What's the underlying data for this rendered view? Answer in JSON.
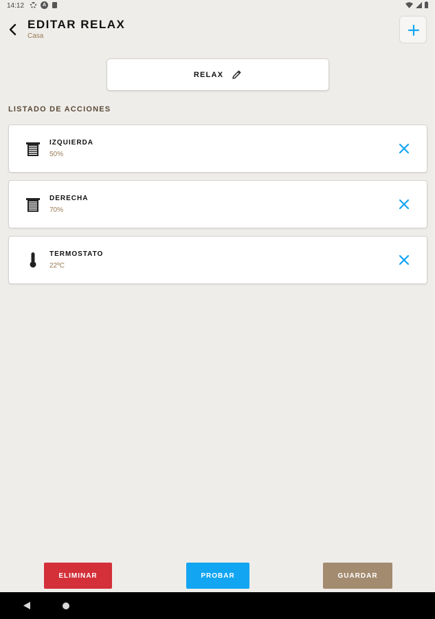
{
  "status_bar": {
    "time": "14:12"
  },
  "header": {
    "title": "EDITAR RELAX",
    "subtitle": "Casa"
  },
  "scene": {
    "name": "RELAX"
  },
  "actions_section": {
    "title": "LISTADO DE ACCIONES",
    "items": [
      {
        "name": "IZQUIERDA",
        "value": "50%",
        "icon": "blind-icon"
      },
      {
        "name": "DERECHA",
        "value": "70%",
        "icon": "blind-icon"
      },
      {
        "name": "TERMOSTATO",
        "value": "22ºC",
        "icon": "thermometer-icon"
      }
    ]
  },
  "buttons": {
    "delete_label": "ELIMINAR",
    "test_label": "PROBAR",
    "save_label": "GUARDAR"
  },
  "colors": {
    "accent_blue": "#12a5f2",
    "delete_red": "#d3303a",
    "save_brown": "#a38b70",
    "value_brown": "#9a7a55",
    "background": "#efedea"
  }
}
